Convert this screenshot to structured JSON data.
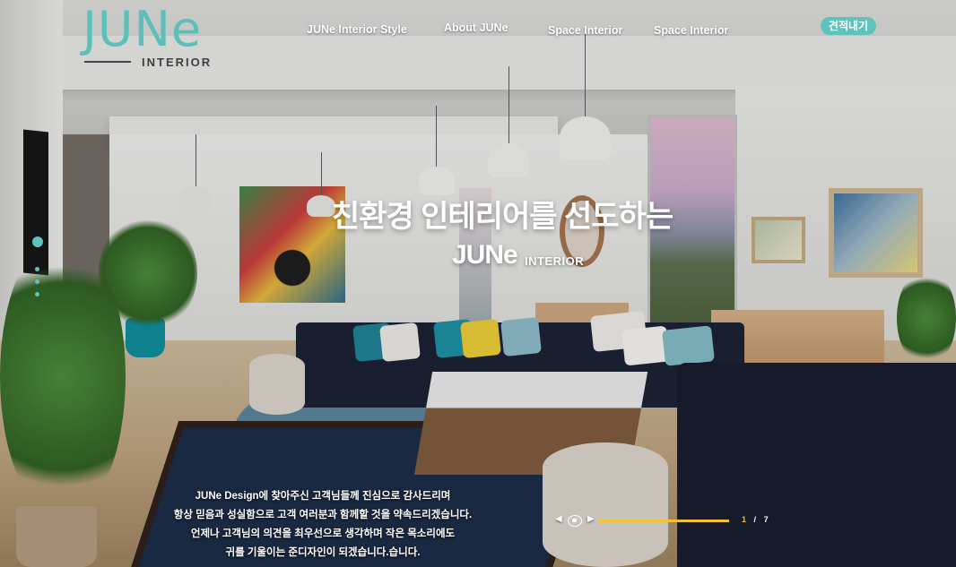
{
  "brand": {
    "logo_word": "JUNe",
    "logo_sub": "INTERIOR",
    "accent_color": "#5ec3bc"
  },
  "nav": {
    "items": [
      {
        "label": "JUNe Interior Style"
      },
      {
        "label": "About JUNe"
      },
      {
        "label": "Space Interior"
      },
      {
        "label": "Space Interior"
      }
    ],
    "estimate_button": "견적내기"
  },
  "hero": {
    "title": "친환경 인테리어를 선도하는",
    "brand": "JUNe",
    "sub": "INTERIOR"
  },
  "intro": {
    "lines": [
      "JUNe Design에 찾아주신 고객님들께 진심으로 감사드리며",
      "항상 믿음과 성실함으로 고객 여러분과 함께할 것을 약속드리겠습니다.",
      "언제나 고객님의 의견을 최우선으로 생각하며 작은 목소리에도",
      "귀를 기울이는 준디자인이 되겠습니다.습니다."
    ]
  },
  "slider": {
    "current": "1",
    "separator": "/",
    "total": "7",
    "progress": 1.0,
    "prev_icon": "prev-arrow-icon",
    "pause_icon": "pause-icon",
    "next_icon": "next-arrow-icon",
    "progress_color": "#f2c230"
  },
  "side_nav": {
    "dots": 3
  }
}
